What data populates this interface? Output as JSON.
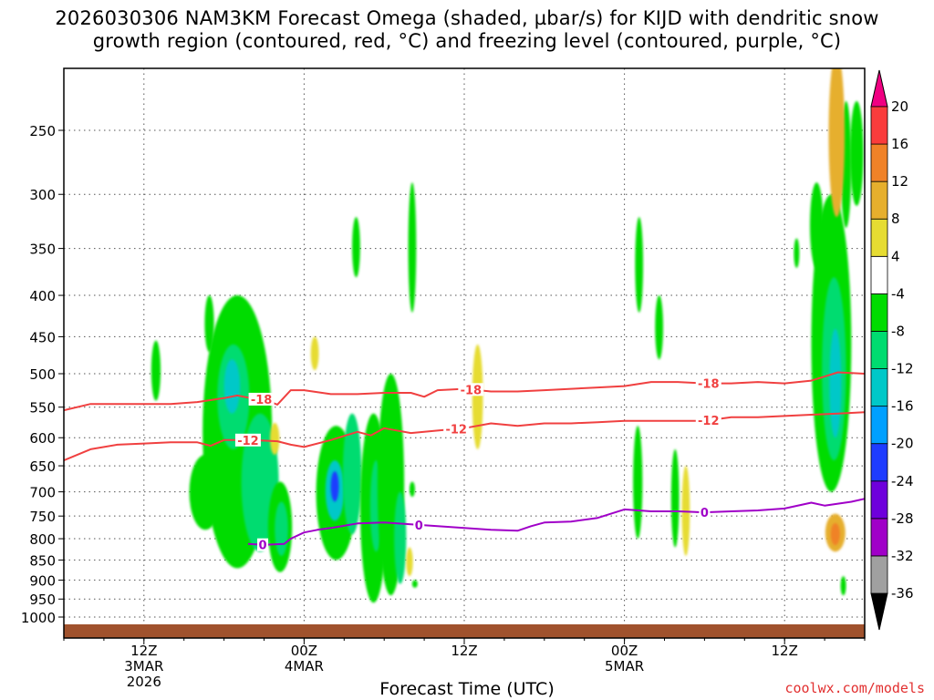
{
  "title_line1": "2026030306 NAM3KM Forecast Omega (shaded, µbar/s) for KIJD with dendritic snow",
  "title_line2": "growth region (contoured, red, °C) and freezing level (contoured, purple, °C)",
  "credit": "coolwx.com/models",
  "chart_data": {
    "type": "heatmap",
    "title": "2026030306 NAM3KM Forecast Omega (shaded, µbar/s) for KIJD with dendritic snow growth region (contoured, red, °C) and freezing level (contoured, purple, °C)",
    "xlabel": "Forecast Time (UTC)",
    "ylabel": "",
    "x_unit": "forecast hour",
    "xlim": [
      0,
      60
    ],
    "ylim": [
      1000,
      200
    ],
    "y_scale": "log-pressure",
    "grid": true,
    "x_ticks": [
      {
        "hour": 6,
        "lines": [
          "12Z",
          "3MAR",
          "2026"
        ]
      },
      {
        "hour": 18,
        "lines": [
          "00Z",
          "4MAR"
        ]
      },
      {
        "hour": 30,
        "lines": [
          "12Z"
        ]
      },
      {
        "hour": 42,
        "lines": [
          "00Z",
          "5MAR"
        ]
      },
      {
        "hour": 54,
        "lines": [
          "12Z"
        ]
      }
    ],
    "y_ticks": [
      250,
      300,
      350,
      400,
      450,
      500,
      550,
      600,
      650,
      700,
      750,
      800,
      850,
      900,
      950,
      1000
    ],
    "colorbar": {
      "levels": [
        -36,
        -32,
        -28,
        -24,
        -20,
        -16,
        -12,
        -8,
        -4,
        4,
        8,
        12,
        16,
        20
      ],
      "colors": [
        "#000000",
        "#a0a0a0",
        "#a000c8",
        "#6e00dc",
        "#1e3cff",
        "#00a0ff",
        "#00c8c8",
        "#00dc70",
        "#00dc00",
        "#ffffff",
        "#e6dc32",
        "#e6af2d",
        "#f08228",
        "#fa3c3c",
        "#f00082"
      ]
    },
    "omega_features": [
      {
        "t": 6.9,
        "p": 500,
        "dt": 0.35,
        "dp_top": 455,
        "dp_bot": 540,
        "v": -6
      },
      {
        "t": 10.9,
        "p": 435,
        "dt": 0.35,
        "dp_top": 400,
        "dp_bot": 470,
        "v": -6
      },
      {
        "t": 13.0,
        "p": 560,
        "dt": 2.6,
        "dp_top": 400,
        "dp_bot": 870,
        "v": -8
      },
      {
        "t": 12.7,
        "p": 520,
        "dt": 1.2,
        "dp_top": 460,
        "dp_bot": 620,
        "v": -12
      },
      {
        "t": 12.6,
        "p": 510,
        "dt": 0.6,
        "dp_top": 480,
        "dp_bot": 560,
        "v": -16
      },
      {
        "t": 10.6,
        "p": 700,
        "dt": 1.2,
        "dp_top": 630,
        "dp_bot": 780,
        "v": -6
      },
      {
        "t": 14.7,
        "p": 640,
        "dt": 1.4,
        "dp_top": 560,
        "dp_bot": 830,
        "v": -10
      },
      {
        "t": 16.2,
        "p": 760,
        "dt": 0.9,
        "dp_top": 680,
        "dp_bot": 880,
        "v": -8
      },
      {
        "t": 16.3,
        "p": 770,
        "dt": 0.5,
        "dp_top": 720,
        "dp_bot": 840,
        "v": -12
      },
      {
        "t": 20.4,
        "p": 730,
        "dt": 1.5,
        "dp_top": 580,
        "dp_bot": 850,
        "v": -8
      },
      {
        "t": 20.3,
        "p": 690,
        "dt": 0.7,
        "dp_top": 640,
        "dp_bot": 760,
        "v": -14
      },
      {
        "t": 20.3,
        "p": 680,
        "dt": 0.3,
        "dp_top": 660,
        "dp_bot": 720,
        "v": -22
      },
      {
        "t": 21.6,
        "p": 650,
        "dt": 0.7,
        "dp_top": 560,
        "dp_bot": 790,
        "v": -10
      },
      {
        "t": 23.2,
        "p": 720,
        "dt": 1.0,
        "dp_top": 560,
        "dp_bot": 960,
        "v": -8
      },
      {
        "t": 23.4,
        "p": 720,
        "dt": 0.45,
        "dp_top": 640,
        "dp_bot": 830,
        "v": -12
      },
      {
        "t": 24.5,
        "p": 700,
        "dt": 1.0,
        "dp_top": 500,
        "dp_bot": 940,
        "v": -8
      },
      {
        "t": 25.2,
        "p": 830,
        "dt": 0.45,
        "dp_top": 700,
        "dp_bot": 910,
        "v": -12
      },
      {
        "t": 21.9,
        "p": 350,
        "dt": 0.3,
        "dp_top": 320,
        "dp_bot": 380,
        "v": -6
      },
      {
        "t": 26.1,
        "p": 350,
        "dt": 0.3,
        "dp_top": 290,
        "dp_bot": 420,
        "v": -6
      },
      {
        "t": 26.1,
        "p": 695,
        "dt": 0.2,
        "dp_top": 680,
        "dp_bot": 710,
        "v": -6
      },
      {
        "t": 26.3,
        "p": 910,
        "dt": 0.15,
        "dp_top": 900,
        "dp_bot": 920,
        "v": -6
      },
      {
        "t": 43.1,
        "p": 370,
        "dt": 0.3,
        "dp_top": 320,
        "dp_bot": 420,
        "v": -6
      },
      {
        "t": 44.6,
        "p": 440,
        "dt": 0.3,
        "dp_top": 400,
        "dp_bot": 480,
        "v": -6
      },
      {
        "t": 43.0,
        "p": 690,
        "dt": 0.35,
        "dp_top": 580,
        "dp_bot": 800,
        "v": -6
      },
      {
        "t": 45.8,
        "p": 720,
        "dt": 0.3,
        "dp_top": 620,
        "dp_bot": 820,
        "v": -6
      },
      {
        "t": 56.4,
        "p": 330,
        "dt": 0.5,
        "dp_top": 290,
        "dp_bot": 370,
        "v": -6
      },
      {
        "t": 54.9,
        "p": 350,
        "dt": 0.2,
        "dp_top": 340,
        "dp_bot": 370,
        "v": -6
      },
      {
        "t": 57.5,
        "p": 440,
        "dt": 1.5,
        "dp_top": 300,
        "dp_bot": 700,
        "v": -8
      },
      {
        "t": 57.7,
        "p": 470,
        "dt": 0.9,
        "dp_top": 380,
        "dp_bot": 640,
        "v": -12
      },
      {
        "t": 57.8,
        "p": 520,
        "dt": 0.45,
        "dp_top": 440,
        "dp_bot": 600,
        "v": -16
      },
      {
        "t": 58.6,
        "p": 280,
        "dt": 0.4,
        "dp_top": 230,
        "dp_bot": 330,
        "v": -6
      },
      {
        "t": 59.4,
        "p": 250,
        "dt": 0.5,
        "dp_top": 230,
        "dp_bot": 310,
        "v": -6
      },
      {
        "t": 58.4,
        "p": 910,
        "dt": 0.2,
        "dp_top": 890,
        "dp_bot": 940,
        "v": -6
      },
      {
        "t": 15.8,
        "p": 600,
        "dt": 0.35,
        "dp_top": 575,
        "dp_bot": 630,
        "v": 6
      },
      {
        "t": 18.8,
        "p": 470,
        "dt": 0.3,
        "dp_top": 450,
        "dp_bot": 495,
        "v": 6
      },
      {
        "t": 25.9,
        "p": 860,
        "dt": 0.25,
        "dp_top": 820,
        "dp_bot": 890,
        "v": 6
      },
      {
        "t": 31.0,
        "p": 540,
        "dt": 0.4,
        "dp_top": 460,
        "dp_bot": 620,
        "v": 6
      },
      {
        "t": 46.6,
        "p": 760,
        "dt": 0.3,
        "dp_top": 650,
        "dp_bot": 840,
        "v": 6
      },
      {
        "t": 57.9,
        "p": 240,
        "dt": 0.6,
        "dp_top": 200,
        "dp_bot": 320,
        "v": 8
      },
      {
        "t": 57.8,
        "p": 790,
        "dt": 0.75,
        "dp_top": 745,
        "dp_bot": 830,
        "v": 8
      },
      {
        "t": 57.8,
        "p": 790,
        "dt": 0.35,
        "dp_top": 765,
        "dp_bot": 815,
        "v": 14
      }
    ],
    "series": [
      {
        "name": "-18",
        "color": "#f04040",
        "points": [
          [
            0,
            555
          ],
          [
            2,
            545
          ],
          [
            4,
            545
          ],
          [
            6,
            545
          ],
          [
            8,
            545
          ],
          [
            10,
            542
          ],
          [
            12,
            536
          ],
          [
            13,
            532
          ],
          [
            14,
            536
          ],
          [
            15,
            538
          ],
          [
            16,
            546
          ],
          [
            17,
            524
          ],
          [
            18,
            524
          ],
          [
            20,
            530
          ],
          [
            22,
            530
          ],
          [
            24,
            528
          ],
          [
            26,
            528
          ],
          [
            27,
            534
          ],
          [
            28,
            524
          ],
          [
            30,
            522
          ],
          [
            32,
            526
          ],
          [
            34,
            526
          ],
          [
            36,
            524
          ],
          [
            38,
            522
          ],
          [
            40,
            520
          ],
          [
            42,
            518
          ],
          [
            44,
            512
          ],
          [
            46,
            512
          ],
          [
            48,
            514
          ],
          [
            50,
            514
          ],
          [
            52,
            512
          ],
          [
            54,
            514
          ],
          [
            56,
            510
          ],
          [
            57,
            504
          ],
          [
            58,
            498
          ],
          [
            59,
            499
          ],
          [
            60,
            500
          ]
        ],
        "labels": [
          {
            "t": 14.8,
            "text": "-18"
          },
          {
            "t": 30.5,
            "text": "-18"
          },
          {
            "t": 48.3,
            "text": "-18"
          }
        ]
      },
      {
        "name": "-12",
        "color": "#f04040",
        "points": [
          [
            0,
            640
          ],
          [
            2,
            620
          ],
          [
            4,
            612
          ],
          [
            6,
            610
          ],
          [
            8,
            608
          ],
          [
            10,
            608
          ],
          [
            11,
            614
          ],
          [
            12,
            604
          ],
          [
            14,
            604
          ],
          [
            16,
            606
          ],
          [
            17,
            612
          ],
          [
            18,
            616
          ],
          [
            20,
            604
          ],
          [
            22,
            590
          ],
          [
            23,
            596
          ],
          [
            24,
            584
          ],
          [
            26,
            592
          ],
          [
            28,
            588
          ],
          [
            30,
            584
          ],
          [
            32,
            576
          ],
          [
            34,
            580
          ],
          [
            36,
            576
          ],
          [
            38,
            576
          ],
          [
            40,
            574
          ],
          [
            42,
            572
          ],
          [
            44,
            572
          ],
          [
            46,
            572
          ],
          [
            48,
            572
          ],
          [
            50,
            566
          ],
          [
            52,
            566
          ],
          [
            54,
            564
          ],
          [
            56,
            562
          ],
          [
            58,
            560
          ],
          [
            60,
            558
          ]
        ],
        "labels": [
          {
            "t": 13.8,
            "text": "-12"
          },
          {
            "t": 29.4,
            "text": "-12"
          },
          {
            "t": 48.3,
            "text": "-12"
          }
        ]
      },
      {
        "name": "0",
        "color": "#a000c8",
        "points": [
          [
            13.8,
            812
          ],
          [
            15,
            814
          ],
          [
            16.5,
            812
          ],
          [
            17,
            800
          ],
          [
            18,
            786
          ],
          [
            19,
            780
          ],
          [
            20,
            776
          ],
          [
            22,
            766
          ],
          [
            24,
            764
          ],
          [
            26,
            768
          ],
          [
            28,
            772
          ],
          [
            30,
            776
          ],
          [
            32,
            780
          ],
          [
            34,
            782
          ],
          [
            35,
            772
          ],
          [
            36,
            764
          ],
          [
            38,
            762
          ],
          [
            40,
            754
          ],
          [
            42,
            736
          ],
          [
            44,
            740
          ],
          [
            46,
            740
          ],
          [
            48,
            742
          ],
          [
            50,
            740
          ],
          [
            52,
            738
          ],
          [
            54,
            734
          ],
          [
            56,
            722
          ],
          [
            57,
            728
          ],
          [
            58,
            724
          ],
          [
            59,
            720
          ],
          [
            60,
            714
          ]
        ],
        "labels": [
          {
            "t": 26.6,
            "text": "0"
          },
          {
            "t": 48.0,
            "text": "0"
          },
          {
            "t": 14.9,
            "text": "0"
          }
        ]
      }
    ]
  }
}
